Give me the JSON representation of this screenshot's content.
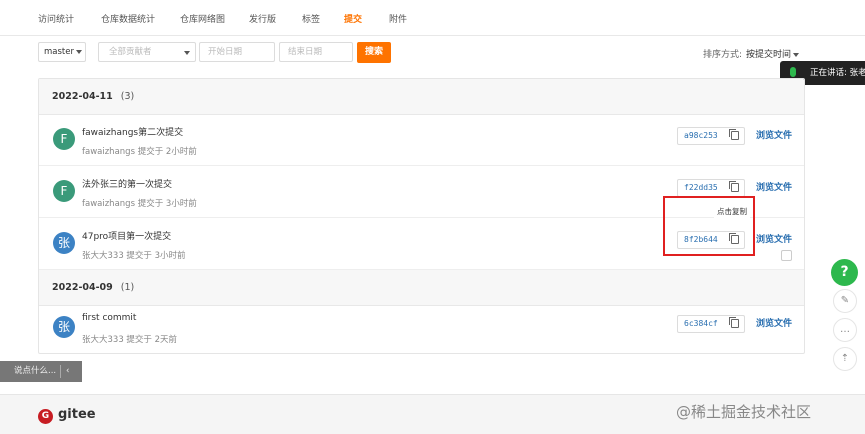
{
  "nav": {
    "tabs": [
      {
        "label": "访问统计",
        "active": false
      },
      {
        "label": "仓库数据统计",
        "active": false
      },
      {
        "label": "仓库网络图",
        "active": false
      },
      {
        "label": "发行版",
        "active": false
      },
      {
        "label": "标签",
        "active": false
      },
      {
        "label": "提交",
        "active": true
      },
      {
        "label": "附件",
        "active": false
      }
    ]
  },
  "filters": {
    "branch": "master",
    "author_placeholder": "全部贡献者",
    "start_date_placeholder": "开始日期",
    "end_date_placeholder": "结束日期",
    "search_label": "搜索",
    "sort_label": "排序方式:",
    "sort_value": "按提交时间"
  },
  "speaking_toast": "正在讲话: 张老",
  "groups": [
    {
      "date": "2022-04-11",
      "count": "(3)",
      "commits": [
        {
          "avatar": "F",
          "title": "fawaizhangs第二次提交",
          "meta": "fawaizhangs 提交于 2小时前",
          "sha": "a98c253",
          "browse": "浏览文件"
        },
        {
          "avatar": "F",
          "title": "法外张三的第一次提交",
          "meta": "fawaizhangs 提交于 3小时前",
          "sha": "f22dd35",
          "browse": "浏览文件"
        },
        {
          "avatar": "张",
          "title": "47pro项目第一次提交",
          "meta": "张大大333 提交于 3小时前",
          "sha": "8f2b644",
          "browse": "浏览文件"
        }
      ]
    },
    {
      "date": "2022-04-09",
      "count": "(1)",
      "commits": [
        {
          "avatar": "张",
          "title": "first commit",
          "meta": "张大大333 提交于 2天前",
          "sha": "6c384cf",
          "browse": "浏览文件"
        }
      ]
    }
  ],
  "tooltip": "点击复制",
  "tray": {
    "label": "说点什么...",
    "chevron": "‹"
  },
  "fab": {
    "help": "?",
    "edit": "✎",
    "comment": "…",
    "top": "⇡"
  },
  "footer": {
    "logo_glyph": "G",
    "brand": "gitee",
    "watermark": "@稀土掘金技术社区"
  },
  "colors": {
    "accent": "#fe7300",
    "link": "#2a6fb0",
    "help": "#2db84d",
    "highlight": "#e02020"
  }
}
